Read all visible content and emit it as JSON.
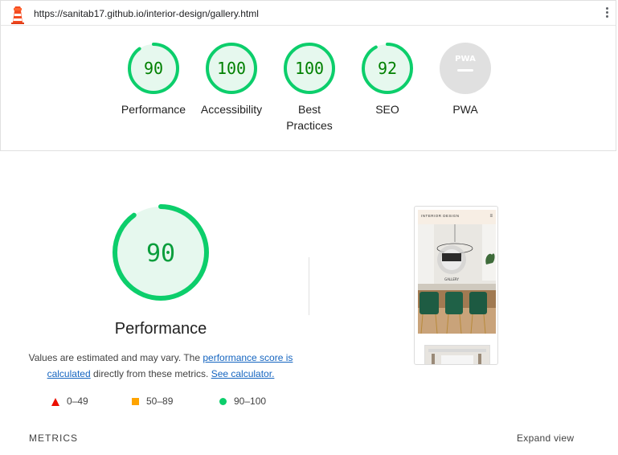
{
  "browser": {
    "url": "https://sanitab17.github.io/interior-design/gallery.html"
  },
  "scores": [
    {
      "label": "Performance",
      "value": "90"
    },
    {
      "label": "Accessibility",
      "value": "100"
    },
    {
      "label": "Best Practices",
      "value": "100"
    },
    {
      "label": "SEO",
      "value": "92"
    },
    {
      "label": "PWA",
      "value": "PWA"
    }
  ],
  "score_fractions": [
    0.9,
    1.0,
    1.0,
    0.92,
    0
  ],
  "performance": {
    "score": "90",
    "score_fraction": 0.9,
    "title": "Performance",
    "desc_prefix": "Values are estimated and may vary. The ",
    "desc_link1": "performance score is calculated",
    "desc_middle": " directly from these metrics. ",
    "desc_link2": "See calculator."
  },
  "legend": [
    {
      "range": "0–49",
      "shape": "triangle",
      "color": "#eb0f00"
    },
    {
      "range": "50–89",
      "shape": "square",
      "color": "#ffa400"
    },
    {
      "range": "90–100",
      "shape": "circle",
      "color": "#0cce6b"
    }
  ],
  "metrics": {
    "heading": "METRICS",
    "expand_label": "Expand view"
  },
  "screenshot": {
    "brand": "INTERIOR DESIGN",
    "menu_icon": "hamburger-icon",
    "hero_text": "GALLERY"
  },
  "colors": {
    "pass": "#0cce6b",
    "pass_text": "#008000",
    "pass_bg": "#e6f8ee",
    "average": "#ffa400",
    "fail": "#eb0f00",
    "na": "#e0e0e0"
  }
}
